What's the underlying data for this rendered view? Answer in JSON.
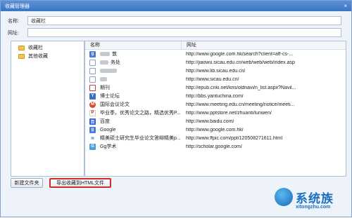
{
  "window": {
    "title": "收藏管理器",
    "close_glyph": "×"
  },
  "form": {
    "name_label": "名称:",
    "name_value": "收藏栏",
    "url_label": "网址:",
    "url_value": ""
  },
  "tree": {
    "items": [
      {
        "label": "收藏栏",
        "icon": "folder-icon"
      },
      {
        "label": "其他收藏",
        "icon": "folder-icon"
      }
    ]
  },
  "table": {
    "headers": {
      "name": "名称",
      "url": "网址"
    },
    "rows": [
      {
        "icon": "google-icon",
        "name": "敦",
        "blurred": true,
        "url": "http://www.google.com.hk/search?client=aff-cs-..."
      },
      {
        "icon": "page-icon",
        "name": "务处",
        "blurred": true,
        "url": "http://jiaowu.sicau.edu.cn/web/web/web/index.asp"
      },
      {
        "icon": "page-icon",
        "name": "",
        "blurred": true,
        "url": "http://www.lib.sicau.edu.cn/"
      },
      {
        "icon": "page-icon",
        "name": "",
        "blurred": true,
        "url": "http://www.sicau.edu.cn/"
      },
      {
        "icon": "journal-icon",
        "name": "期刊",
        "blurred": true,
        "url": "http://epub.cnki.net/kns/oldnavi/n_list.aspx?Navil..."
      },
      {
        "icon": "yantu-icon",
        "name": "博士论坛",
        "blurred": false,
        "url": "http://bbs.yantuchina.com/"
      },
      {
        "icon": "meeting-icon",
        "name": "国际会议论文",
        "blurred": false,
        "url": "http://www.meeting.edu.cn/meeting/notice/meeti..."
      },
      {
        "icon": "pptstore-icon",
        "name": "毕业季，优秀论文之路，精选优秀P...",
        "blurred": false,
        "url": "http://www.pptstore.net/zhuanti/lunwen/"
      },
      {
        "icon": "baidu-icon",
        "name": "百度",
        "blurred": false,
        "url": "http://www.baidu.com/"
      },
      {
        "icon": "google-icon",
        "name": "Google",
        "blurred": false,
        "url": "http://www.google.com.hk/"
      },
      {
        "icon": "ppt-icon",
        "name": "精美硕士研究生毕业论文答辩精美p...",
        "blurred": false,
        "url": "http://www.ffpic.com/ppt/120508271611.html"
      },
      {
        "icon": "scholar-icon",
        "name": "Gg学术",
        "blurred": false,
        "url": "http://scholar.google.com/"
      }
    ]
  },
  "buttons": {
    "new_folder": "新建文件夹",
    "export_html": "导出收藏到HTML文件"
  },
  "watermark": {
    "brand": "系统族",
    "url": "xitongzhu.com"
  }
}
